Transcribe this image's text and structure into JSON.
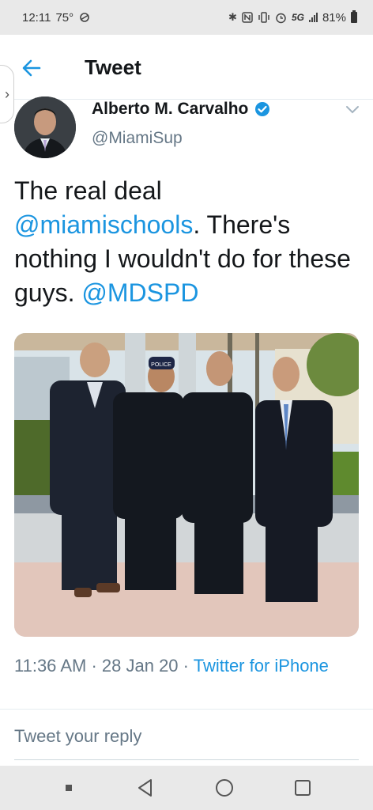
{
  "status_bar": {
    "time": "12:11",
    "temperature": "75°",
    "network": "5G",
    "battery_percent": "81%",
    "icons": [
      "weather-icon",
      "bluetooth-icon",
      "nfc-icon",
      "vibrate-icon",
      "alarm-icon",
      "signal-icon",
      "battery-icon"
    ]
  },
  "header": {
    "title": "Tweet",
    "back_icon": "back-arrow-icon"
  },
  "tweet": {
    "author_name": "Alberto M. Carvalho",
    "author_handle": "@MiamiSup",
    "text_1": "The real deal",
    "mention_1": "@miamischools",
    "text_2": ". There's nothing I wouldn't do for these guys. ",
    "mention_2": "@MDSPD",
    "photo_label": "POLICE",
    "time": "11:36 AM",
    "date": "28 Jan 20",
    "source": "Twitter for iPhone"
  },
  "reply": {
    "placeholder": "Tweet your reply"
  },
  "colors": {
    "accent": "#1b95e0",
    "text": "#14171a",
    "muted": "#657786"
  }
}
